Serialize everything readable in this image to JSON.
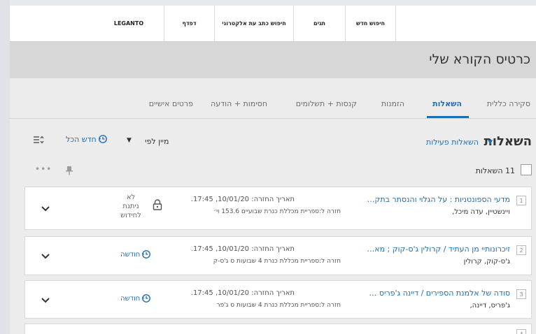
{
  "nav": {
    "items": [
      {
        "label": "LEGANTO"
      },
      {
        "label": "דפדף"
      },
      {
        "label": "חיפוש כתב עת אלקטרוני"
      },
      {
        "label": "תגים"
      },
      {
        "label": "חיפוש חדש"
      }
    ]
  },
  "page": {
    "title": "כרטיס הקורא שלי"
  },
  "tabs": [
    {
      "label": "סקירה כללית"
    },
    {
      "label": "השאלות"
    },
    {
      "label": "הזמנות"
    },
    {
      "label": "קנסות + תשלומים"
    },
    {
      "label": "חסימות + הודעה"
    },
    {
      "label": "פרטים אישיים"
    }
  ],
  "loans": {
    "section_title": "השאלות",
    "filter": "השאלות פעילות",
    "sort_label": "מיין לפי",
    "renew_all": "חדש הכל",
    "count_text": "11 השאלות",
    "dots": "•••",
    "items": [
      {
        "num": "1",
        "title": "מדעי הספונטניות : על הגלוי והנסתר בתק…",
        "author": "ויינשטיין, עדה מיכל,",
        "due": "תאריך החזרה: 10/01/20, 17:45.",
        "return_to": "חזרה ל:ספריית מכללת כנרת שבועיים 153.6 וי׳",
        "status": "לא ניתנת לחידוש",
        "status_line1": "לא",
        "status_line2": "ניתנת",
        "status_line3": "לחידוש"
      },
      {
        "num": "2",
        "title": "זיכרונותיי מן העתיד / קרולין ג'ס-קוק ; מא…",
        "author": "ג'ס-קוק, קרולין",
        "due": "תאריך החזרה: 10/01/20, 17:45.",
        "return_to": "חזרה ל:ספריית מכללת כנרת 4 שבועות ס ג'ס-ק",
        "status": "חודשה"
      },
      {
        "num": "3",
        "title": "סודה של אלמנת הספירים / דיינה ג'פריס …",
        "author": "ג'פריס, דיינה,",
        "due": "תאריך החזרה: 10/01/20, 17:45.",
        "return_to": "חזרה ל:ספריית מכללת כנרת 4 שבועות ס ג'פר",
        "status": "חודשה"
      },
      {
        "num": "4"
      }
    ]
  },
  "colors": {
    "accent": "#1f6fb2",
    "title_bar": "#d7d7d7",
    "background": "#ececec"
  }
}
